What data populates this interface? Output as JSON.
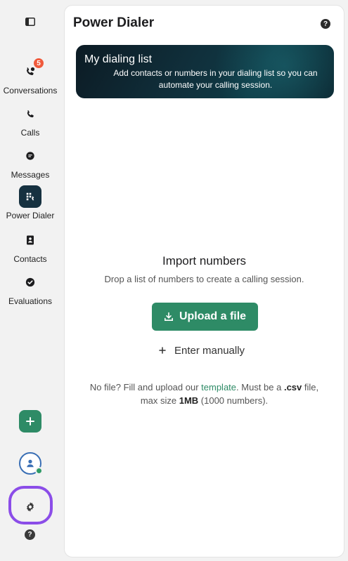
{
  "sidebar": {
    "items": [
      {
        "label": "Conversations",
        "badge": "5",
        "icon": "phone-chat-icon"
      },
      {
        "label": "Calls",
        "icon": "phone-icon"
      },
      {
        "label": "Messages",
        "icon": "message-icon"
      },
      {
        "label": "Power Dialer",
        "icon": "power-dialer-icon",
        "active": true
      },
      {
        "label": "Contacts",
        "icon": "contact-book-icon"
      },
      {
        "label": "Evaluations",
        "icon": "check-circle-icon"
      }
    ],
    "help_glyph": "?"
  },
  "panel": {
    "title": "Power Dialer",
    "help_glyph": "?"
  },
  "banner": {
    "title": "My dialing list",
    "text": "Add contacts or numbers in your dialing list so you can automate your calling session."
  },
  "import": {
    "title": "Import numbers",
    "subtitle": "Drop a list of numbers to create a calling session.",
    "upload_label": "Upload a file",
    "manual_label": "Enter manually",
    "note_prefix": "No file? Fill and upload our ",
    "note_link": "template",
    "note_mid": ". Must be a ",
    "note_ext": ".csv",
    "note_mid2": " file,",
    "note_line2_prefix": "max size ",
    "note_size": "1MB",
    "note_line2_suffix": " (1000 numbers)."
  },
  "colors": {
    "accent": "#2e8b66",
    "active_nav": "#163140",
    "badge": "#f05a3c",
    "highlight": "#8b4de8"
  }
}
